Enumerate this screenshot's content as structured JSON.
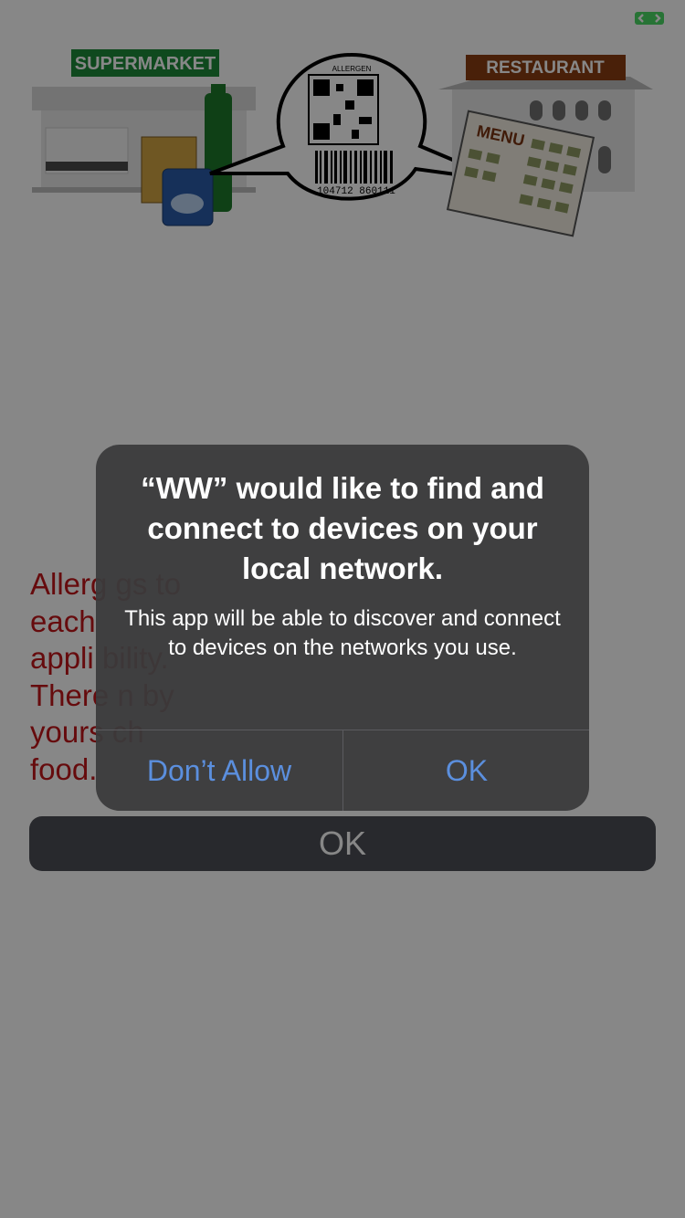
{
  "hero": {
    "supermarket_sign": "SUPERMARKET",
    "restaurant_sign": "RESTAURANT",
    "menu_label": "MENU",
    "qr_caption": "ALLERGEN",
    "barcode_digits": "104712 860111"
  },
  "disclaimer": {
    "text": "Allerg                                              gs to\neach\nappli                                              bility.\nThere                                              n by\nyours                                              ch\nfood."
  },
  "main": {
    "ok_label": "OK"
  },
  "alert": {
    "title": "“WW” would like to find and connect to devices on your local network.",
    "message": "This app will be able to discover and connect to devices on the networks you use.",
    "deny_label": "Don’t Allow",
    "allow_label": "OK"
  },
  "colors": {
    "accent": "#5b8fde",
    "alert_background": "#3a3a3c",
    "disclaimer_text": "#c0151a",
    "button_background": "#4d4f55"
  }
}
